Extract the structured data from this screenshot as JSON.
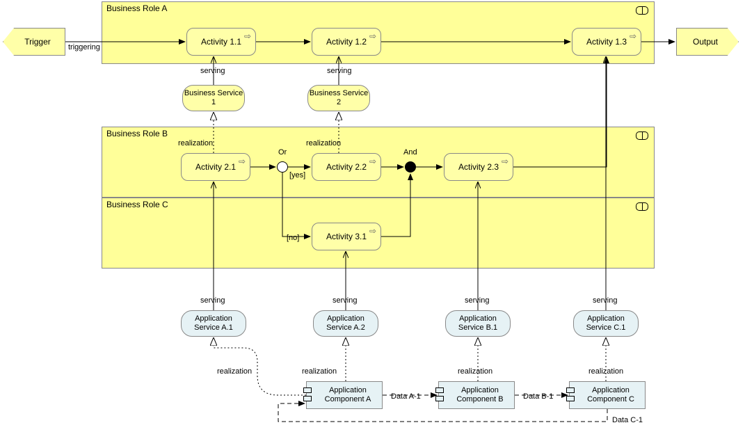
{
  "events": {
    "trigger": "Trigger",
    "output": "Output"
  },
  "lanes": {
    "a": "Business Role A",
    "b": "Business Role B",
    "c": "Business Role C"
  },
  "activities": {
    "a11": "Activity 1.1",
    "a12": "Activity 1.2",
    "a13": "Activity 1.3",
    "a21": "Activity 2.1",
    "a22": "Activity 2.2",
    "a23": "Activity 2.3",
    "a31": "Activity 3.1"
  },
  "gateways": {
    "or": "Or",
    "and": "And",
    "yes": "[yes]",
    "no": "[no]"
  },
  "bservices": {
    "s1": "Business Service 1",
    "s2": "Business Service 2"
  },
  "aservices": {
    "sa1": "Application Service A.1",
    "sa2": "Application Service A.2",
    "sb1": "Application Service B.1",
    "sc1": "Application Service C.1"
  },
  "acomponents": {
    "ca": "Application Component A",
    "cb": "Application Component B",
    "cc": "Application Component C"
  },
  "labels": {
    "triggering": "triggering",
    "serving": "serving",
    "realization": "realization",
    "da1": "Data A-1",
    "db1": "Data B-1",
    "dc1": "Data C-1"
  }
}
